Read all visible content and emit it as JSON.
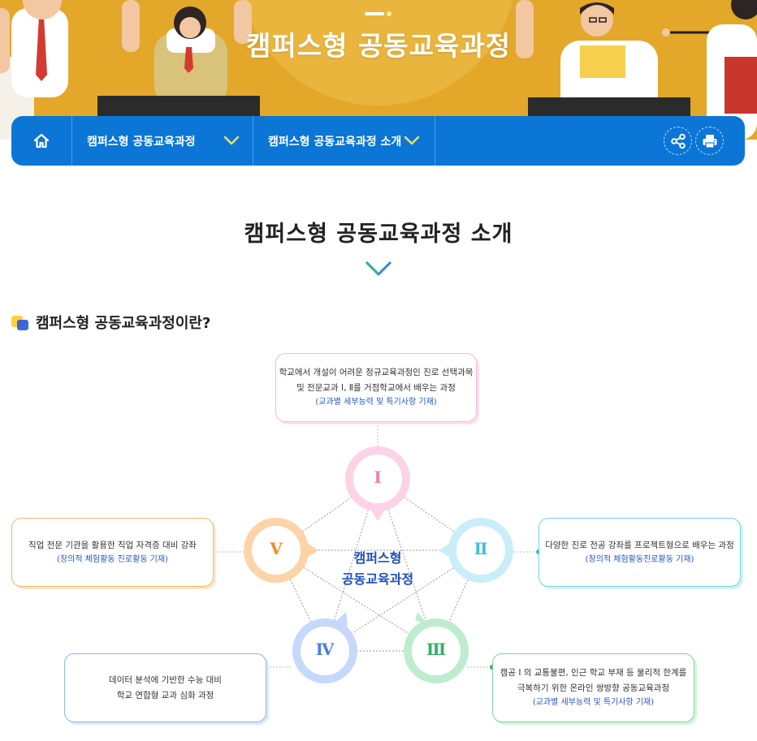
{
  "hero": {
    "title": "캠퍼스형 공동교육과정"
  },
  "nav": {
    "home_icon": "home-icon",
    "item1_label": "캠퍼스형 공동교육과정",
    "item2_label": "캠퍼스형 공동교육과정 소개",
    "share_icon": "share-icon",
    "print_icon": "print-icon"
  },
  "main": {
    "heading": "캠퍼스형 공동교육과정 소개",
    "subheading": "캠퍼스형 공동교육과정이란?"
  },
  "diagram": {
    "center": [
      "캠퍼스형",
      "공동교육과정"
    ],
    "nodes": [
      {
        "numeral": "Ⅰ",
        "color": "#f27bb3",
        "ring": "#fcd3e6",
        "lines": [
          "학교에서 개설이 어려운 정규교육과정인 진로 선택과목",
          "및 전문교과 Ⅰ, Ⅱ를 거점학교에서 배우는 과정"
        ],
        "note": "(교과별 세부능력 및 특기사항 기재)"
      },
      {
        "numeral": "Ⅱ",
        "color": "#3dbde0",
        "ring": "#c9eef9",
        "lines": [
          "다양한 진로 전공 강좌를 프로젝트형으로 배우는 과정"
        ],
        "note": "(창의적 체험활동진로활동 기재)"
      },
      {
        "numeral": "Ⅲ",
        "color": "#2fb267",
        "ring": "#bfeccf",
        "lines": [
          "캠공 Ⅰ 의 교통불편, 인근 학교 부재 등 물리적 한계를",
          "극복하기 위한 온라인 쌍방향 공동교육과정"
        ],
        "note": "(교과별 세부능력 및 특기사항 기재)"
      },
      {
        "numeral": "Ⅳ",
        "color": "#4d7fe0",
        "ring": "#c6d8fb",
        "lines": [
          "데이터 분석에 기반한 수능 대비",
          "학교 연합형 교과 심화 과정"
        ],
        "note": ""
      },
      {
        "numeral": "Ⅴ",
        "color": "#f28a1d",
        "ring": "#fdd3a8",
        "lines": [
          "직업 전문 기관을 활용한 직업 자격증 대비 강좌"
        ],
        "note": "(창의적 체험활동 진로활동 기재)"
      }
    ]
  }
}
